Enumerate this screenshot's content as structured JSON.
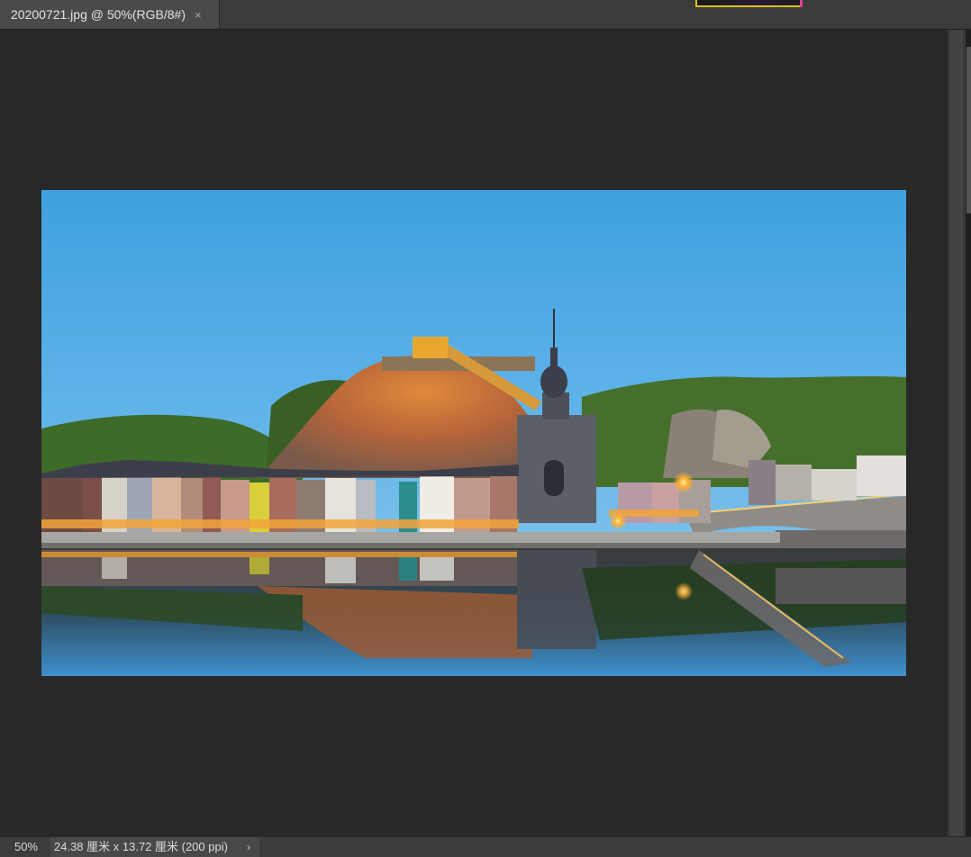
{
  "tab": {
    "title": "20200721.jpg @ 50%(RGB/8#)",
    "close_glyph": "×"
  },
  "statusbar": {
    "zoom": "50%",
    "document_info": "24.38 厘米 x 13.72 厘米 (200 ppi)",
    "arrow_glyph": "›"
  },
  "image": {
    "description_icon": "landscape-photo"
  }
}
